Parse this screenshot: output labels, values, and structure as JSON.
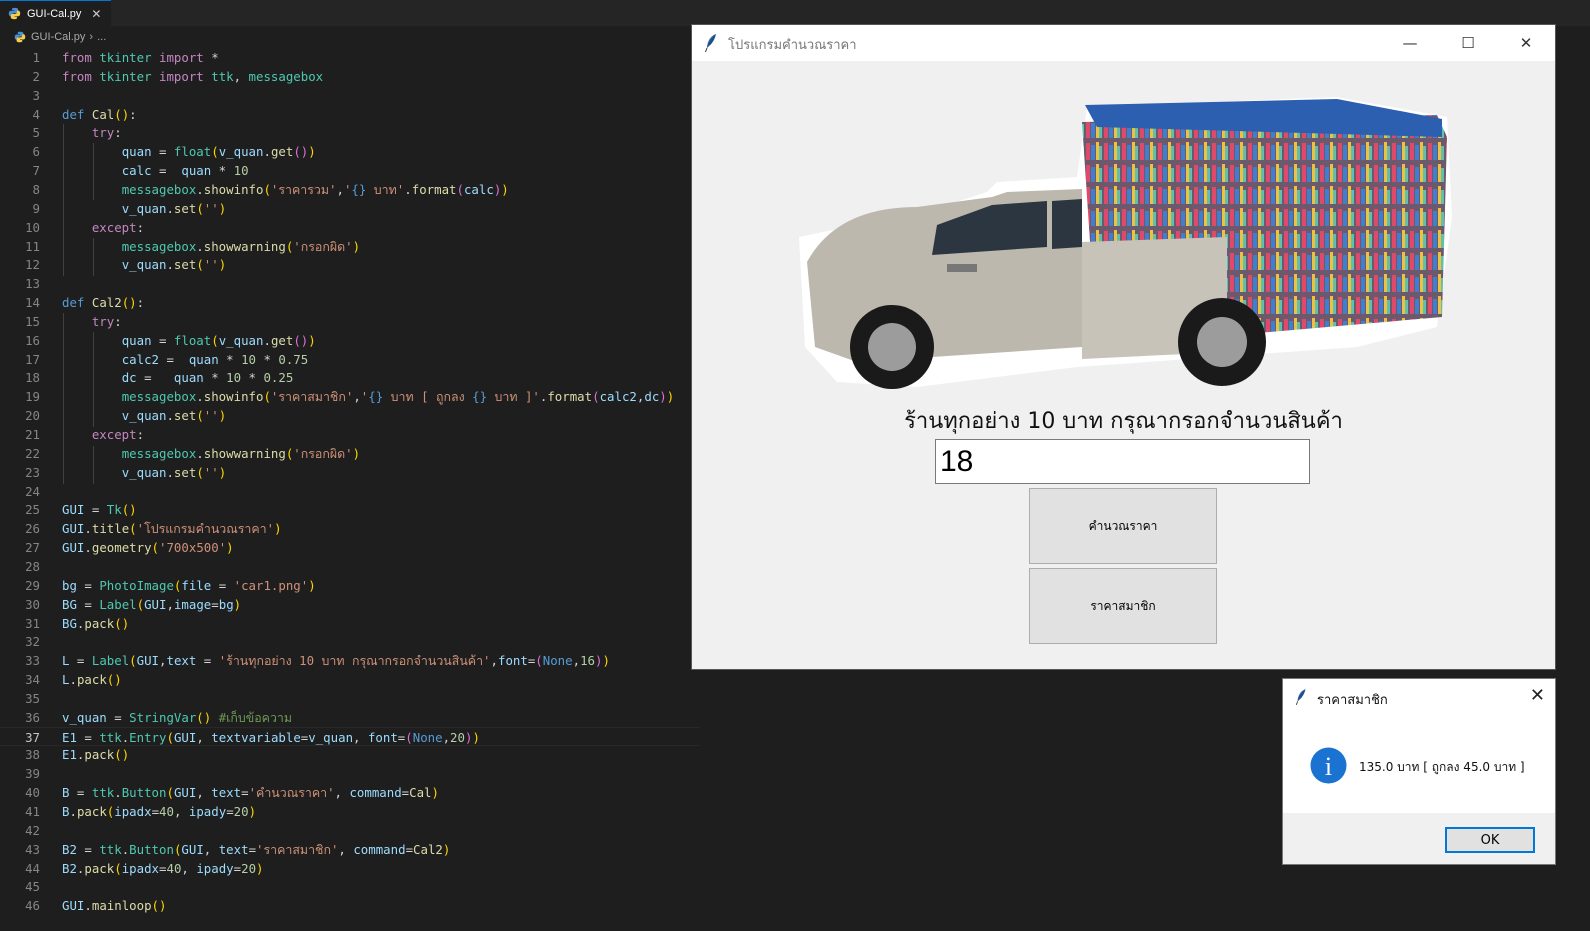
{
  "editor": {
    "tab_label": "GUI-Cal.py",
    "breadcrumb_file": "GUI-Cal.py",
    "breadcrumb_rest": "...",
    "current_line": 37,
    "lines": [
      [
        [
          "k",
          "from"
        ],
        [
          "t",
          " "
        ],
        [
          "m",
          "tkinter"
        ],
        [
          "t",
          " "
        ],
        [
          "k",
          "import"
        ],
        [
          "t",
          " *"
        ]
      ],
      [
        [
          "k",
          "from"
        ],
        [
          "t",
          " "
        ],
        [
          "m",
          "tkinter"
        ],
        [
          "t",
          " "
        ],
        [
          "k",
          "import"
        ],
        [
          "t",
          " "
        ],
        [
          "m",
          "ttk"
        ],
        [
          "t",
          ", "
        ],
        [
          "m",
          "messagebox"
        ]
      ],
      [],
      [
        [
          "d",
          "def"
        ],
        [
          "t",
          " "
        ],
        [
          "f",
          "Cal"
        ],
        [
          "b1",
          "()"
        ],
        [
          "t",
          ":"
        ]
      ],
      [
        [
          "t",
          "    "
        ],
        [
          "k",
          "try"
        ],
        [
          "t",
          ":"
        ]
      ],
      [
        [
          "t",
          "        "
        ],
        [
          "v",
          "quan"
        ],
        [
          "t",
          " = "
        ],
        [
          "m",
          "float"
        ],
        [
          "b1",
          "("
        ],
        [
          "v",
          "v_quan"
        ],
        [
          "t",
          "."
        ],
        [
          "f",
          "get"
        ],
        [
          "b2",
          "()"
        ],
        [
          "b1",
          ")"
        ]
      ],
      [
        [
          "t",
          "        "
        ],
        [
          "v",
          "calc"
        ],
        [
          "t",
          " =  "
        ],
        [
          "v",
          "quan"
        ],
        [
          "t",
          " * "
        ],
        [
          "n",
          "10"
        ]
      ],
      [
        [
          "t",
          "        "
        ],
        [
          "m",
          "messagebox"
        ],
        [
          "t",
          "."
        ],
        [
          "f",
          "showinfo"
        ],
        [
          "b1",
          "("
        ],
        [
          "s",
          "'ราคารวม'"
        ],
        [
          "t",
          ","
        ],
        [
          "s",
          "'"
        ],
        [
          "d",
          "{}"
        ],
        [
          "s",
          " บาท'"
        ],
        [
          "t",
          "."
        ],
        [
          "f",
          "format"
        ],
        [
          "b2",
          "("
        ],
        [
          "v",
          "calc"
        ],
        [
          "b2",
          ")"
        ],
        [
          "b1",
          ")"
        ]
      ],
      [
        [
          "t",
          "        "
        ],
        [
          "v",
          "v_quan"
        ],
        [
          "t",
          "."
        ],
        [
          "f",
          "set"
        ],
        [
          "b1",
          "("
        ],
        [
          "s",
          "''"
        ],
        [
          "b1",
          ")"
        ]
      ],
      [
        [
          "t",
          "    "
        ],
        [
          "k",
          "except"
        ],
        [
          "t",
          ":"
        ]
      ],
      [
        [
          "t",
          "        "
        ],
        [
          "m",
          "messagebox"
        ],
        [
          "t",
          "."
        ],
        [
          "f",
          "showwarning"
        ],
        [
          "b1",
          "("
        ],
        [
          "s",
          "'กรอกผิด'"
        ],
        [
          "b1",
          ")"
        ]
      ],
      [
        [
          "t",
          "        "
        ],
        [
          "v",
          "v_quan"
        ],
        [
          "t",
          "."
        ],
        [
          "f",
          "set"
        ],
        [
          "b1",
          "("
        ],
        [
          "s",
          "''"
        ],
        [
          "b1",
          ")"
        ]
      ],
      [],
      [
        [
          "d",
          "def"
        ],
        [
          "t",
          " "
        ],
        [
          "f",
          "Cal2"
        ],
        [
          "b1",
          "()"
        ],
        [
          "t",
          ":"
        ]
      ],
      [
        [
          "t",
          "    "
        ],
        [
          "k",
          "try"
        ],
        [
          "t",
          ":"
        ]
      ],
      [
        [
          "t",
          "        "
        ],
        [
          "v",
          "quan"
        ],
        [
          "t",
          " = "
        ],
        [
          "m",
          "float"
        ],
        [
          "b1",
          "("
        ],
        [
          "v",
          "v_quan"
        ],
        [
          "t",
          "."
        ],
        [
          "f",
          "get"
        ],
        [
          "b2",
          "()"
        ],
        [
          "b1",
          ")"
        ]
      ],
      [
        [
          "t",
          "        "
        ],
        [
          "v",
          "calc2"
        ],
        [
          "t",
          " =  "
        ],
        [
          "v",
          "quan"
        ],
        [
          "t",
          " * "
        ],
        [
          "n",
          "10"
        ],
        [
          "t",
          " * "
        ],
        [
          "n",
          "0.75"
        ]
      ],
      [
        [
          "t",
          "        "
        ],
        [
          "v",
          "dc"
        ],
        [
          "t",
          " =   "
        ],
        [
          "v",
          "quan"
        ],
        [
          "t",
          " * "
        ],
        [
          "n",
          "10"
        ],
        [
          "t",
          " * "
        ],
        [
          "n",
          "0.25"
        ]
      ],
      [
        [
          "t",
          "        "
        ],
        [
          "m",
          "messagebox"
        ],
        [
          "t",
          "."
        ],
        [
          "f",
          "showinfo"
        ],
        [
          "b1",
          "("
        ],
        [
          "s",
          "'ราคาสมาชิก'"
        ],
        [
          "t",
          ","
        ],
        [
          "s",
          "'"
        ],
        [
          "d",
          "{}"
        ],
        [
          "s",
          " บาท [ ถูกลง "
        ],
        [
          "d",
          "{}"
        ],
        [
          "s",
          " บาท ]'"
        ],
        [
          "t",
          "."
        ],
        [
          "f",
          "format"
        ],
        [
          "b2",
          "("
        ],
        [
          "v",
          "calc2"
        ],
        [
          "t",
          ","
        ],
        [
          "v",
          "dc"
        ],
        [
          "b2",
          ")"
        ],
        [
          "b1",
          ")"
        ]
      ],
      [
        [
          "t",
          "        "
        ],
        [
          "v",
          "v_quan"
        ],
        [
          "t",
          "."
        ],
        [
          "f",
          "set"
        ],
        [
          "b1",
          "("
        ],
        [
          "s",
          "''"
        ],
        [
          "b1",
          ")"
        ]
      ],
      [
        [
          "t",
          "    "
        ],
        [
          "k",
          "except"
        ],
        [
          "t",
          ":"
        ]
      ],
      [
        [
          "t",
          "        "
        ],
        [
          "m",
          "messagebox"
        ],
        [
          "t",
          "."
        ],
        [
          "f",
          "showwarning"
        ],
        [
          "b1",
          "("
        ],
        [
          "s",
          "'กรอกผิด'"
        ],
        [
          "b1",
          ")"
        ]
      ],
      [
        [
          "t",
          "        "
        ],
        [
          "v",
          "v_quan"
        ],
        [
          "t",
          "."
        ],
        [
          "f",
          "set"
        ],
        [
          "b1",
          "("
        ],
        [
          "s",
          "''"
        ],
        [
          "b1",
          ")"
        ]
      ],
      [],
      [
        [
          "v",
          "GUI"
        ],
        [
          "t",
          " = "
        ],
        [
          "m",
          "Tk"
        ],
        [
          "b1",
          "()"
        ]
      ],
      [
        [
          "v",
          "GUI"
        ],
        [
          "t",
          "."
        ],
        [
          "f",
          "title"
        ],
        [
          "b1",
          "("
        ],
        [
          "s",
          "'โปรแกรมคำนวณราคา'"
        ],
        [
          "b1",
          ")"
        ]
      ],
      [
        [
          "v",
          "GUI"
        ],
        [
          "t",
          "."
        ],
        [
          "f",
          "geometry"
        ],
        [
          "b1",
          "("
        ],
        [
          "s",
          "'700x500'"
        ],
        [
          "b1",
          ")"
        ]
      ],
      [],
      [
        [
          "v",
          "bg"
        ],
        [
          "t",
          " = "
        ],
        [
          "m",
          "PhotoImage"
        ],
        [
          "b1",
          "("
        ],
        [
          "v",
          "file"
        ],
        [
          "t",
          " = "
        ],
        [
          "s",
          "'car1.png'"
        ],
        [
          "b1",
          ")"
        ]
      ],
      [
        [
          "v",
          "BG"
        ],
        [
          "t",
          " = "
        ],
        [
          "m",
          "Label"
        ],
        [
          "b1",
          "("
        ],
        [
          "v",
          "GUI"
        ],
        [
          "t",
          ","
        ],
        [
          "v",
          "image"
        ],
        [
          "t",
          "="
        ],
        [
          "v",
          "bg"
        ],
        [
          "b1",
          ")"
        ]
      ],
      [
        [
          "v",
          "BG"
        ],
        [
          "t",
          "."
        ],
        [
          "f",
          "pack"
        ],
        [
          "b1",
          "()"
        ]
      ],
      [],
      [
        [
          "v",
          "L"
        ],
        [
          "t",
          " = "
        ],
        [
          "m",
          "Label"
        ],
        [
          "b1",
          "("
        ],
        [
          "v",
          "GUI"
        ],
        [
          "t",
          ","
        ],
        [
          "v",
          "text"
        ],
        [
          "t",
          " = "
        ],
        [
          "s",
          "'ร้านทุกอย่าง 10 บาท กรุณากรอกจำนวนสินค้า'"
        ],
        [
          "t",
          ","
        ],
        [
          "v",
          "font"
        ],
        [
          "t",
          "="
        ],
        [
          "b2",
          "("
        ],
        [
          "d",
          "None"
        ],
        [
          "t",
          ","
        ],
        [
          "n",
          "16"
        ],
        [
          "b2",
          ")"
        ],
        [
          "b1",
          ")"
        ]
      ],
      [
        [
          "v",
          "L"
        ],
        [
          "t",
          "."
        ],
        [
          "f",
          "pack"
        ],
        [
          "b1",
          "()"
        ]
      ],
      [],
      [
        [
          "v",
          "v_quan"
        ],
        [
          "t",
          " = "
        ],
        [
          "m",
          "StringVar"
        ],
        [
          "b1",
          "()"
        ],
        [
          "t",
          " "
        ],
        [
          "c",
          "#เก็บข้อความ"
        ]
      ],
      [
        [
          "v",
          "E1"
        ],
        [
          "t",
          " = "
        ],
        [
          "m",
          "ttk"
        ],
        [
          "t",
          "."
        ],
        [
          "m",
          "Entry"
        ],
        [
          "b1",
          "("
        ],
        [
          "v",
          "GUI"
        ],
        [
          "t",
          ", "
        ],
        [
          "v",
          "textvariable"
        ],
        [
          "t",
          "="
        ],
        [
          "v",
          "v_quan"
        ],
        [
          "t",
          ", "
        ],
        [
          "v",
          "font"
        ],
        [
          "t",
          "="
        ],
        [
          "b2",
          "("
        ],
        [
          "d",
          "None"
        ],
        [
          "t",
          ","
        ],
        [
          "n",
          "20"
        ],
        [
          "b2",
          ")"
        ],
        [
          "b1",
          ")"
        ]
      ],
      [
        [
          "v",
          "E1"
        ],
        [
          "t",
          "."
        ],
        [
          "f",
          "pack"
        ],
        [
          "b1",
          "()"
        ]
      ],
      [],
      [
        [
          "v",
          "B"
        ],
        [
          "t",
          " = "
        ],
        [
          "m",
          "ttk"
        ],
        [
          "t",
          "."
        ],
        [
          "m",
          "Button"
        ],
        [
          "b1",
          "("
        ],
        [
          "v",
          "GUI"
        ],
        [
          "t",
          ", "
        ],
        [
          "v",
          "text"
        ],
        [
          "t",
          "="
        ],
        [
          "s",
          "'คำนวณราคา'"
        ],
        [
          "t",
          ", "
        ],
        [
          "v",
          "command"
        ],
        [
          "t",
          "="
        ],
        [
          "f",
          "Cal"
        ],
        [
          "b1",
          ")"
        ]
      ],
      [
        [
          "v",
          "B"
        ],
        [
          "t",
          "."
        ],
        [
          "f",
          "pack"
        ],
        [
          "b1",
          "("
        ],
        [
          "v",
          "ipadx"
        ],
        [
          "t",
          "="
        ],
        [
          "n",
          "40"
        ],
        [
          "t",
          ", "
        ],
        [
          "v",
          "ipady"
        ],
        [
          "t",
          "="
        ],
        [
          "n",
          "20"
        ],
        [
          "b1",
          ")"
        ]
      ],
      [],
      [
        [
          "v",
          "B2"
        ],
        [
          "t",
          " = "
        ],
        [
          "m",
          "ttk"
        ],
        [
          "t",
          "."
        ],
        [
          "m",
          "Button"
        ],
        [
          "b1",
          "("
        ],
        [
          "v",
          "GUI"
        ],
        [
          "t",
          ", "
        ],
        [
          "v",
          "text"
        ],
        [
          "t",
          "="
        ],
        [
          "s",
          "'ราคาสมาชิก'"
        ],
        [
          "t",
          ", "
        ],
        [
          "v",
          "command"
        ],
        [
          "t",
          "="
        ],
        [
          "f",
          "Cal2"
        ],
        [
          "b1",
          ")"
        ]
      ],
      [
        [
          "v",
          "B2"
        ],
        [
          "t",
          "."
        ],
        [
          "f",
          "pack"
        ],
        [
          "b1",
          "("
        ],
        [
          "v",
          "ipadx"
        ],
        [
          "t",
          "="
        ],
        [
          "n",
          "40"
        ],
        [
          "t",
          ", "
        ],
        [
          "v",
          "ipady"
        ],
        [
          "t",
          "="
        ],
        [
          "n",
          "20"
        ],
        [
          "b1",
          ")"
        ]
      ],
      [],
      [
        [
          "v",
          "GUI"
        ],
        [
          "t",
          "."
        ],
        [
          "f",
          "mainloop"
        ],
        [
          "b1",
          "()"
        ]
      ]
    ]
  },
  "app_window": {
    "title": "โปรแกรมคำนวณราคา",
    "label": "ร้านทุกอย่าง 10 บาท กรุณากรอกจำนวนสินค้า",
    "entry_value": "18",
    "button_calc": "คำนวณราคา",
    "button_member": "ราคาสมาชิก",
    "minimize": "—",
    "maximize": "☐",
    "close": "✕"
  },
  "dialog": {
    "title": "ราคาสมาชิก",
    "message": "135.0 บาท [ ถูกลง 45.0 บาท ]",
    "ok": "OK",
    "close": "✕",
    "info_glyph": "i"
  },
  "icons": {
    "python_file": "python-file-icon",
    "tk_feather": "feather-icon",
    "info": "info-icon"
  }
}
